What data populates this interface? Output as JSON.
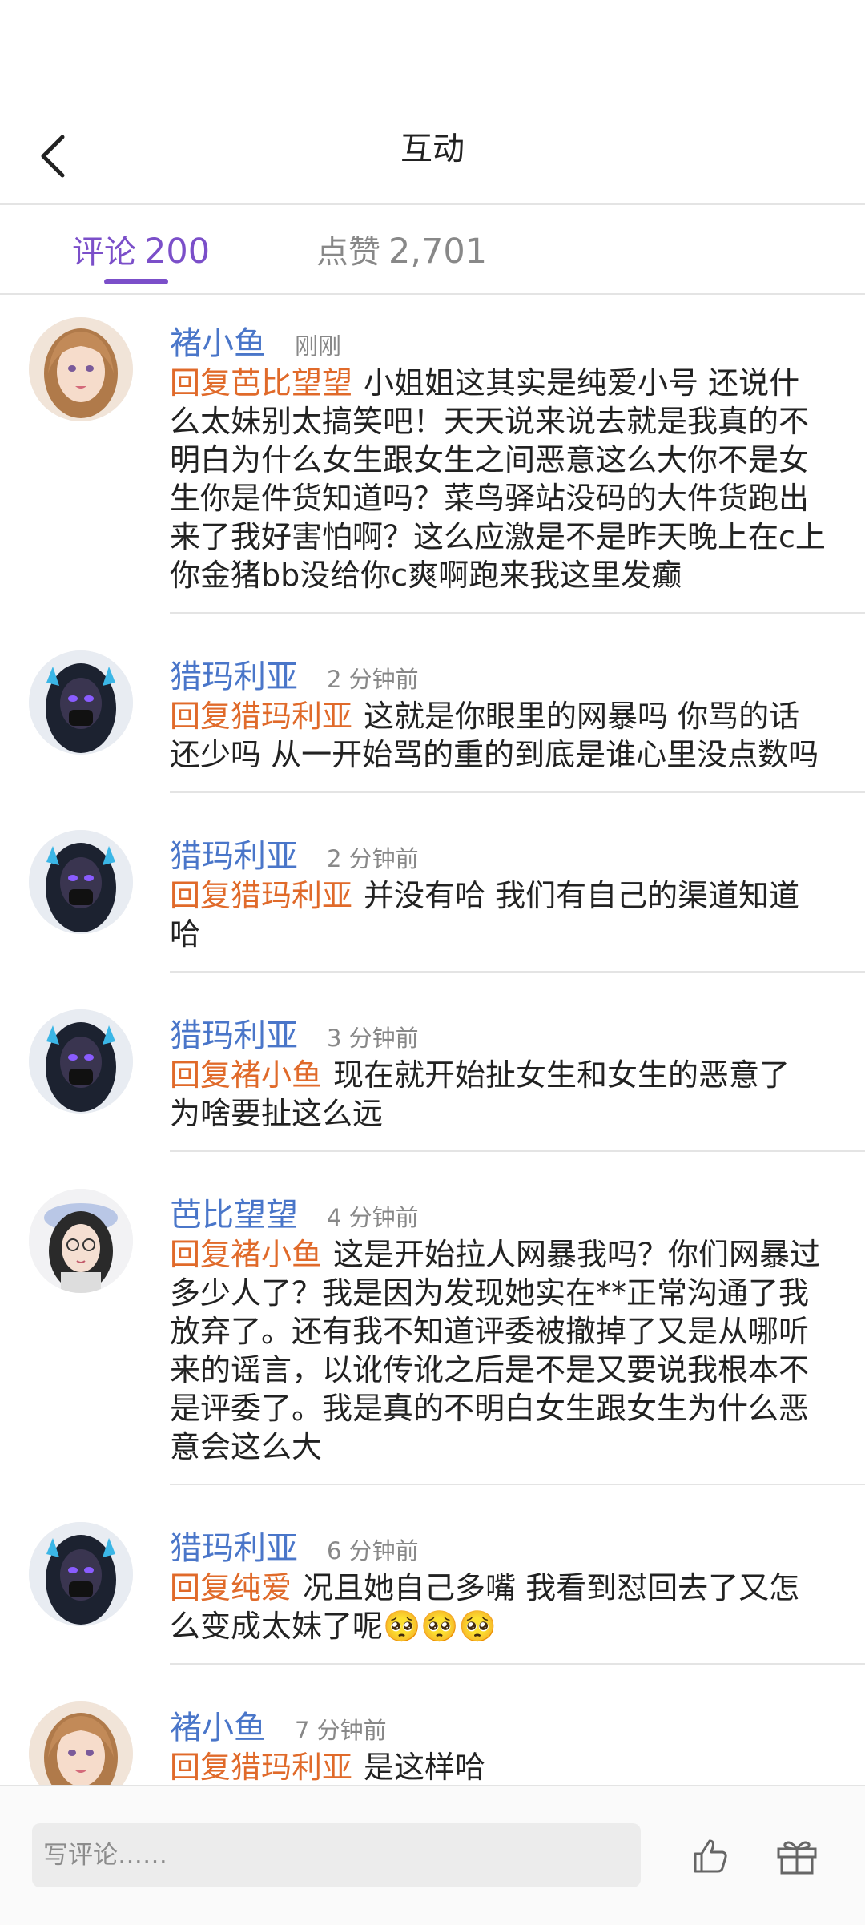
{
  "header": {
    "title": "互动"
  },
  "tabs": [
    {
      "label": "评论",
      "count": "200"
    },
    {
      "label": "点赞",
      "count": "2,701"
    }
  ],
  "comments": [
    {
      "avatar": "avatar-female-light-hair-icon",
      "username": "褚小鱼",
      "time": "刚刚",
      "reply_to": "回复芭比望望",
      "text": "小姐姐这其实是纯爱小号 还说什么太妹别太搞笑吧！天天说来说去就是我真的不明白为什么女生跟女生之间恶意这么大你不是女生你是件货知道吗？菜鸟驿站没码的大件货跑出来了我好害怕啊？这么应激是不是昨天晚上在c上你金猪bb没给你c爽啊跑来我这里发癫"
    },
    {
      "avatar": "avatar-masked-cyber-icon",
      "username": "猎玛利亚",
      "time": "2 分钟前",
      "reply_to": "回复猎玛利亚",
      "text": "这就是你眼里的网暴吗 你骂的话还少吗 从一开始骂的重的到底是谁心里没点数吗"
    },
    {
      "avatar": "avatar-masked-cyber-icon",
      "username": "猎玛利亚",
      "time": "2 分钟前",
      "reply_to": "回复猎玛利亚",
      "text": "并没有哈 我们有自己的渠道知道哈"
    },
    {
      "avatar": "avatar-masked-cyber-icon",
      "username": "猎玛利亚",
      "time": "3 分钟前",
      "reply_to": "回复褚小鱼",
      "text": "现在就开始扯女生和女生的恶意了 为啥要扯这么远"
    },
    {
      "avatar": "avatar-beret-glasses-icon",
      "username": "芭比望望",
      "time": "4 分钟前",
      "reply_to": "回复褚小鱼",
      "text": "这是开始拉人网暴我吗？你们网暴过多少人了？我是因为发现她实在**正常沟通了我放弃了。还有我不知道评委被撤掉了又是从哪听来的谣言，以讹传讹之后是不是又要说我根本不是评委了。我是真的不明白女生跟女生为什么恶意会这么大"
    },
    {
      "avatar": "avatar-masked-cyber-icon",
      "username": "猎玛利亚",
      "time": "6 分钟前",
      "reply_to": "回复纯爱",
      "text": "况且她自己多嘴 我看到怼回去了又怎么变成太妹了呢🥺🥺🥺"
    },
    {
      "avatar": "avatar-female-light-hair-icon",
      "username": "褚小鱼",
      "time": "7 分钟前",
      "reply_to": "回复猎玛利亚",
      "text": "是这样哈"
    }
  ],
  "bottom_bar": {
    "input_placeholder": "写评论……"
  },
  "colors": {
    "accent": "#7b4fc9",
    "username": "#4a76c9",
    "reply": "#e06a2a"
  }
}
